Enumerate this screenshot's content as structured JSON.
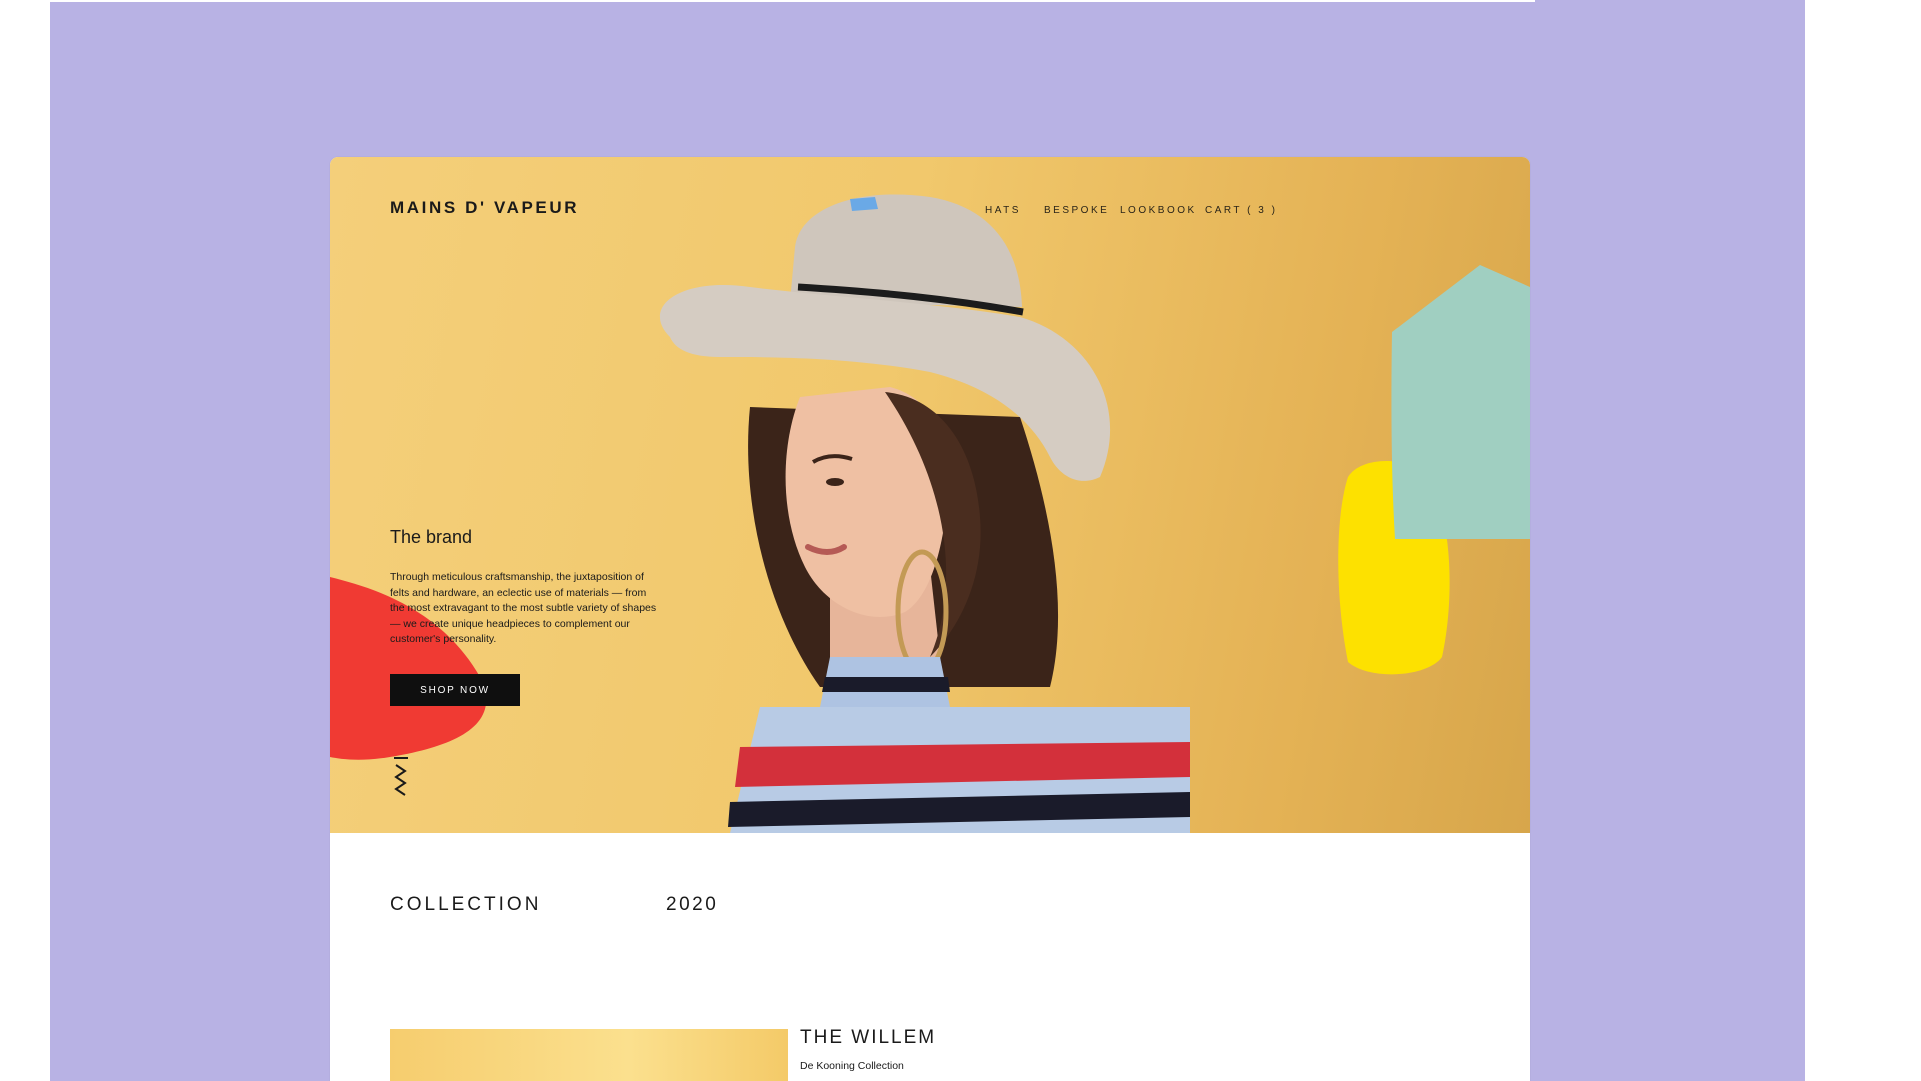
{
  "colors": {
    "background_lavender": "#b8b2e4",
    "hero_yellow": "#f1c86c",
    "accent_red": "#f03a33",
    "accent_mint": "#a0cfc1",
    "accent_yellow": "#fde100",
    "button_black": "#0f0f0f"
  },
  "header": {
    "logo": "MAINS D' VAPEUR",
    "nav": [
      {
        "label": "HATS"
      },
      {
        "label": "BESPOKE"
      },
      {
        "label": "LOOKBOOK"
      },
      {
        "label": "CART ( 3 )"
      }
    ]
  },
  "hero": {
    "heading": "The brand",
    "body": "Through meticulous craftsmanship, the juxtaposition of felts and hardware, an eclectic use of materials — from the most extravagant to the most subtle variety of shapes — we create unique headpieces to complement our customer's personality.",
    "cta_label": "SHOP NOW",
    "image": "model-wearing-grey-fedora-hat"
  },
  "collection": {
    "title": "COLLECTION",
    "year": "2020"
  },
  "product": {
    "name": "THE WILLEM",
    "subtitle": "De Kooning Collection"
  }
}
